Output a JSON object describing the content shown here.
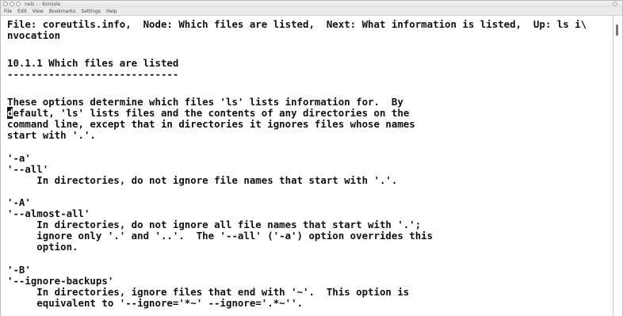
{
  "window": {
    "title": "nelz : - Konsole"
  },
  "menubar": {
    "items": [
      "File",
      "Edit",
      "View",
      "Bookmarks",
      "Settings",
      "Help"
    ]
  },
  "terminal": {
    "cursor_char": "d",
    "lines": [
      "File: coreutils.info,  Node: Which files are listed,  Next: What information is listed,  Up: ls i\\",
      "nvocation",
      "",
      "10.1.1 Which files are listed",
      "-----------------------------",
      "",
      "These options determine which files 'ls' lists information for.  By",
      "efault, 'ls' lists files and the contents of any directories on the",
      "command line, except that in directories it ignores files whose names",
      "start with '.'.",
      "",
      "'-a'",
      "'--all'",
      "     In directories, do not ignore file names that start with '.'.",
      "",
      "'-A'",
      "'--almost-all'",
      "     In directories, do not ignore all file names that start with '.';",
      "     ignore only '.' and '..'.  The '--all' ('-a') option overrides this",
      "     option.",
      "",
      "'-B'",
      "'--ignore-backups'",
      "     In directories, ignore files that end with '~'.  This option is",
      "     equivalent to '--ignore='*~' --ignore='.*~''."
    ]
  }
}
